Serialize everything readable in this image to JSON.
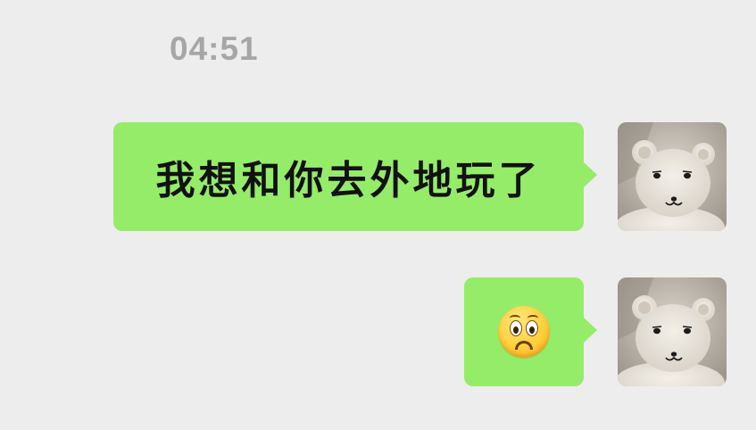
{
  "chat": {
    "timestamp": "04:51",
    "messages": [
      {
        "type": "text",
        "text": "我想和你去外地玩了",
        "sender": "self",
        "bubble_color": "#95ec69"
      },
      {
        "type": "emoji",
        "emoji": "frowning-face",
        "sender": "self",
        "bubble_color": "#95ec69"
      }
    ],
    "avatar": {
      "icon": "white-teddy-bear-plush"
    }
  },
  "colors": {
    "background": "#ededed",
    "bubble": "#95ec69",
    "timestamp": "#a6a6a6",
    "text": "#111111"
  }
}
